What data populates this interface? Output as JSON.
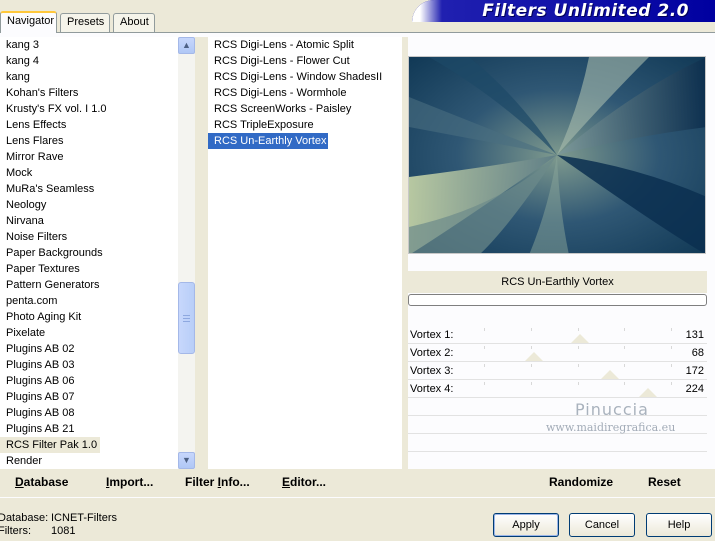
{
  "banner": {
    "title": "Filters Unlimited 2.0"
  },
  "tabs": [
    {
      "label": "Navigator"
    },
    {
      "label": "Presets"
    },
    {
      "label": "About"
    }
  ],
  "categories": [
    "kang 3",
    "kang 4",
    "kang",
    "Kohan's Filters",
    "Krusty's FX vol. I 1.0",
    "Lens Effects",
    "Lens Flares",
    "Mirror Rave",
    "Mock",
    "MuRa's Seamless",
    "Neology",
    "Nirvana",
    "Noise Filters",
    "Paper Backgrounds",
    "Paper Textures",
    "Pattern Generators",
    "penta.com",
    "Photo Aging Kit",
    "Pixelate",
    "Plugins AB 02",
    "Plugins AB 03",
    "Plugins AB 06",
    "Plugins AB 07",
    "Plugins AB 08",
    "Plugins AB 21",
    "RCS Filter Pak 1.0",
    "Render"
  ],
  "selected_category_index": 25,
  "filters": [
    "RCS Digi-Lens - Atomic Split",
    "RCS Digi-Lens - Flower Cut",
    "RCS Digi-Lens - Window ShadesII",
    "RCS Digi-Lens - Wormhole",
    "RCS ScreenWorks - Paisley",
    "RCS TripleExposure",
    "RCS Un-Earthly Vortex"
  ],
  "selected_filter_index": 6,
  "preview": {
    "filter_name": "RCS Un-Earthly Vortex"
  },
  "sliders": [
    {
      "label": "Vortex 1:",
      "value": 131
    },
    {
      "label": "Vortex 2:",
      "value": 68
    },
    {
      "label": "Vortex 3:",
      "value": 172
    },
    {
      "label": "Vortex 4:",
      "value": 224
    }
  ],
  "slider_max": 255,
  "watermark": {
    "name": "Pinuccia",
    "url": "www.maidiregrafica.eu"
  },
  "actions": {
    "database": {
      "label": "Database",
      "mnemonic": "D",
      "rest": "atabase"
    },
    "import": {
      "label": "Import...",
      "mnemonic": "I",
      "rest": "mport..."
    },
    "filter_info": {
      "label": "Filter Info...",
      "pre": "Filter ",
      "mnemonic": "I",
      "rest": "nfo..."
    },
    "editor": {
      "label": "Editor...",
      "mnemonic": "E",
      "rest": "ditor..."
    },
    "randomize": {
      "label": "Randomize"
    },
    "reset": {
      "label": "Reset"
    }
  },
  "status": {
    "database_label": "Database:",
    "database_value": "ICNET-Filters",
    "filters_label": "Filters:",
    "filters_value": "1081"
  },
  "buttons": {
    "apply": "Apply",
    "cancel": "Cancel",
    "help": "Help"
  },
  "colors": {
    "selection": "#316ac5",
    "banner": "#0000a0",
    "preview_dark": "#0e3a58",
    "preview_light": "#c6d2a8"
  }
}
